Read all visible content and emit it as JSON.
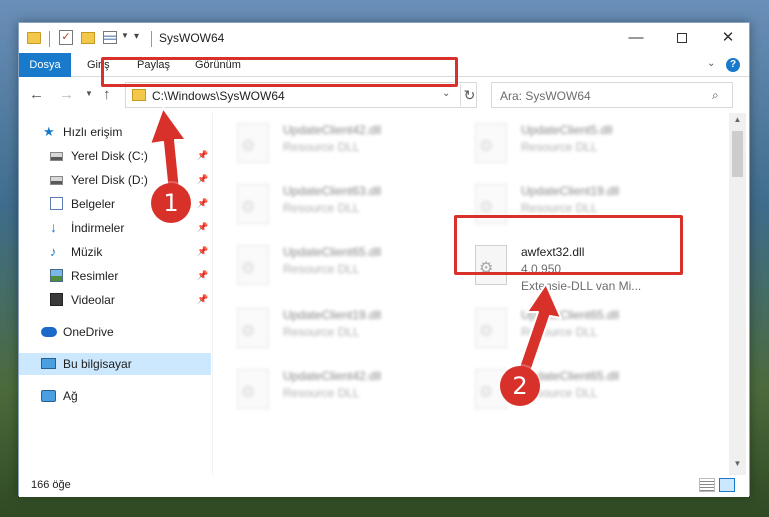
{
  "window": {
    "title": "SysWOW64",
    "buttons": {
      "minimize": "—",
      "close": "✕"
    }
  },
  "ribbon": {
    "tabs": [
      "Dosya",
      "Giriş",
      "Paylaş",
      "Görünüm"
    ],
    "help": "?"
  },
  "navigation": {
    "address": "C:\\Windows\\SysWOW64",
    "search_placeholder": "Ara: SysWOW64"
  },
  "sidebar": {
    "items": [
      {
        "label": "Hızlı erişim",
        "icon": "star-icon"
      },
      {
        "label": "Yerel Disk (C:)",
        "icon": "disk-icon",
        "pinned": true
      },
      {
        "label": "Yerel Disk (D:)",
        "icon": "disk-icon",
        "pinned": true
      },
      {
        "label": "Belgeler",
        "icon": "document-icon",
        "pinned": true
      },
      {
        "label": "İndirmeler",
        "icon": "download-icon",
        "pinned": true
      },
      {
        "label": "Müzik",
        "icon": "music-icon",
        "pinned": true
      },
      {
        "label": "Resimler",
        "icon": "picture-icon",
        "pinned": true
      },
      {
        "label": "Videolar",
        "icon": "video-icon",
        "pinned": true
      },
      {
        "label": "OneDrive",
        "icon": "cloud-icon"
      },
      {
        "label": "Bu bilgisayar",
        "icon": "computer-icon",
        "selected": true
      },
      {
        "label": "Ağ",
        "icon": "network-icon"
      }
    ]
  },
  "files": [
    {
      "name": "UpdateClient42.dll",
      "type": "Resource DLL"
    },
    {
      "name": "UpdateClient5.dll",
      "type": "Resource DLL"
    },
    {
      "name": "UpdateClient63.dll",
      "type": "Resource DLL"
    },
    {
      "name": "UpdateClient19.dll",
      "type": "Resource DLL"
    },
    {
      "name": "UpdateClient65.dll",
      "type": "Resource DLL"
    },
    {
      "name": "awfext32.dll",
      "version": "4.0.950",
      "type": "Extensie-DLL van Mi..."
    },
    {
      "name": "UpdateClient19.dll",
      "type": "Resource DLL"
    },
    {
      "name": "UpdateClient65.dll",
      "type": "Resource DLL"
    },
    {
      "name": "UpdateClient42.dll",
      "type": "Resource DLL"
    },
    {
      "name": "UpdateClient65.dll",
      "type": "Resource DLL"
    }
  ],
  "status": {
    "count": "166 öğe"
  },
  "annotations": {
    "step1": "1",
    "step2": "2",
    "color": "#d8312a"
  }
}
